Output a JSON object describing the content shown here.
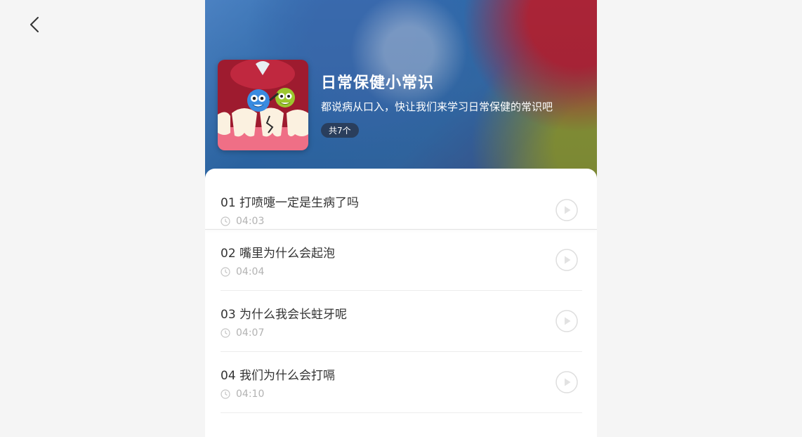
{
  "nav": {
    "back_icon": "chevron-left-icon"
  },
  "album": {
    "title": "日常保健小常识",
    "subtitle": "都说病从口入，快让我们来学习日常保健的常识吧",
    "count": "共7个",
    "cover_icon": "teeth-germs-illustration"
  },
  "episodes": [
    {
      "title": "01 打喷嚏一定是生病了吗",
      "duration": "04:03"
    },
    {
      "title": "02 嘴里为什么会起泡",
      "duration": "04:04"
    },
    {
      "title": "03 为什么我会长蛀牙呢",
      "duration": "04:07"
    },
    {
      "title": "04 我们为什么会打嗝",
      "duration": "04:10"
    }
  ],
  "colors": {
    "accent": "#2f6fb4",
    "text_primary": "#333333",
    "text_secondary": "#b2b2b2"
  }
}
